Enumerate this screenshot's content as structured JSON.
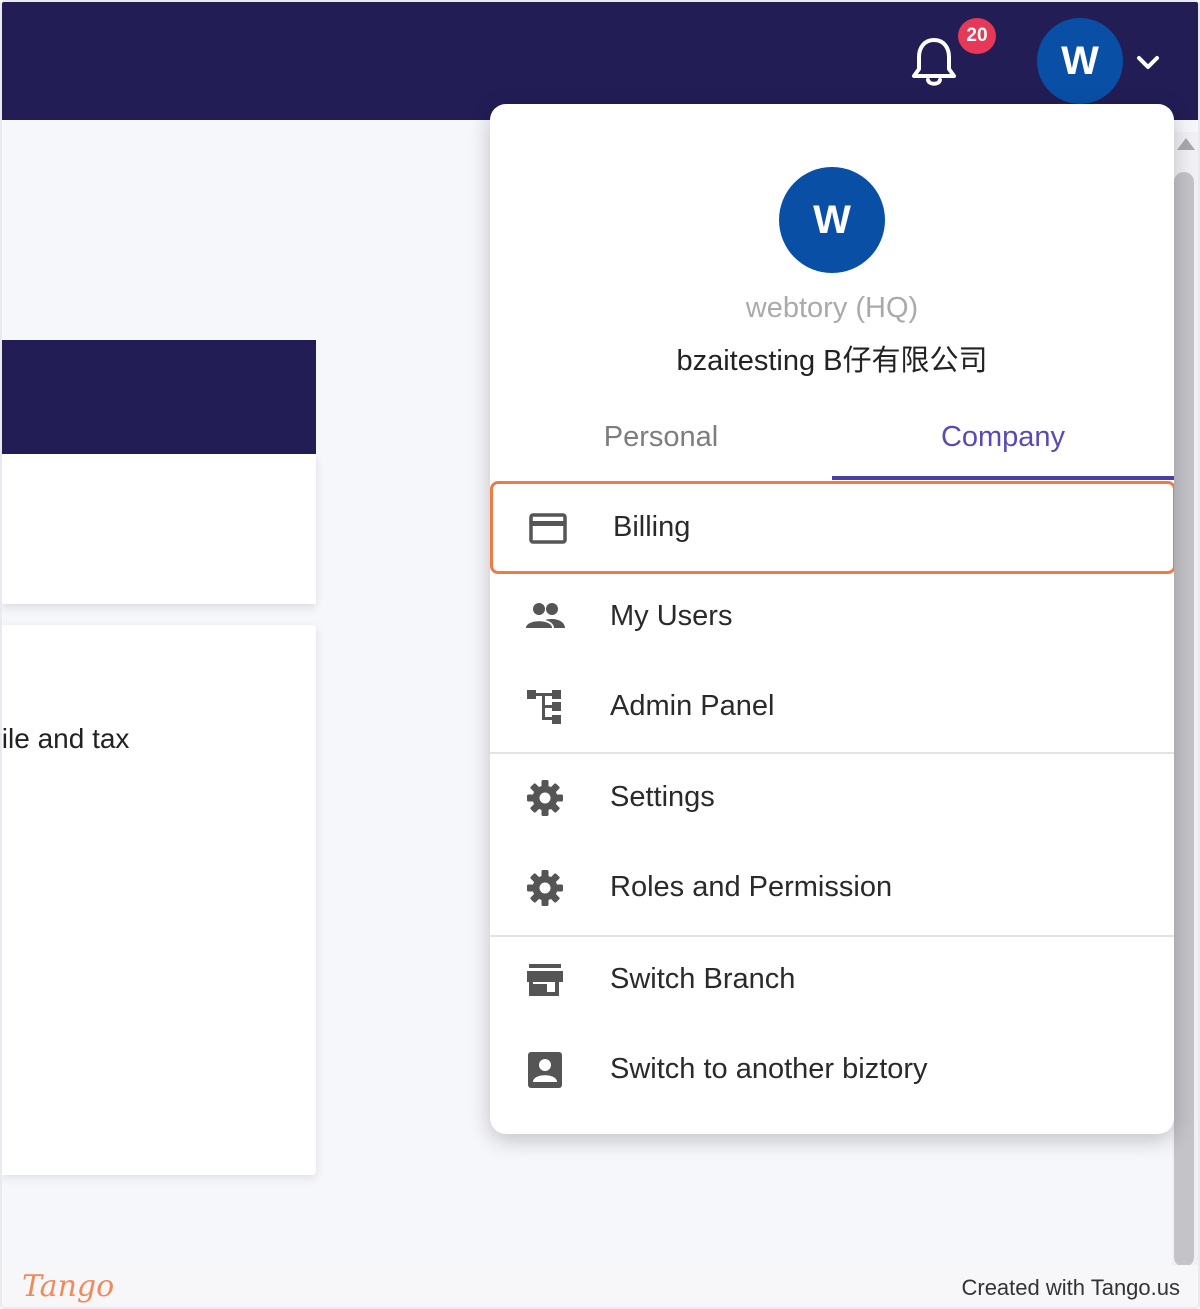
{
  "topbar": {
    "notification_count": "20",
    "avatar_initial": "W"
  },
  "background": {
    "card_text": "file and tax"
  },
  "menu": {
    "avatar_initial": "W",
    "branch_name": "webtory (HQ)",
    "company_name": "bzaitesting B仔有限公司",
    "tabs": [
      {
        "label": "Personal",
        "active": false
      },
      {
        "label": "Company",
        "active": true
      }
    ],
    "items": [
      {
        "label": "Billing",
        "icon": "credit-card-icon",
        "highlighted": true
      },
      {
        "label": "My Users",
        "icon": "users-icon"
      },
      {
        "label": "Admin Panel",
        "icon": "org-chart-icon"
      },
      {
        "label": "Settings",
        "icon": "gear-icon"
      },
      {
        "label": "Roles and Permission",
        "icon": "gear-icon"
      },
      {
        "label": "Switch Branch",
        "icon": "store-icon"
      },
      {
        "label": "Switch to another biztory",
        "icon": "account-box-icon"
      }
    ]
  },
  "footer": {
    "logo": "Tango",
    "credit": "Created with Tango.us"
  },
  "colors": {
    "topbar": "#221e55",
    "avatar": "#0a4fa6",
    "badge": "#e63957",
    "active_tab": "#5a4bb4",
    "highlight": "#f07a46"
  }
}
